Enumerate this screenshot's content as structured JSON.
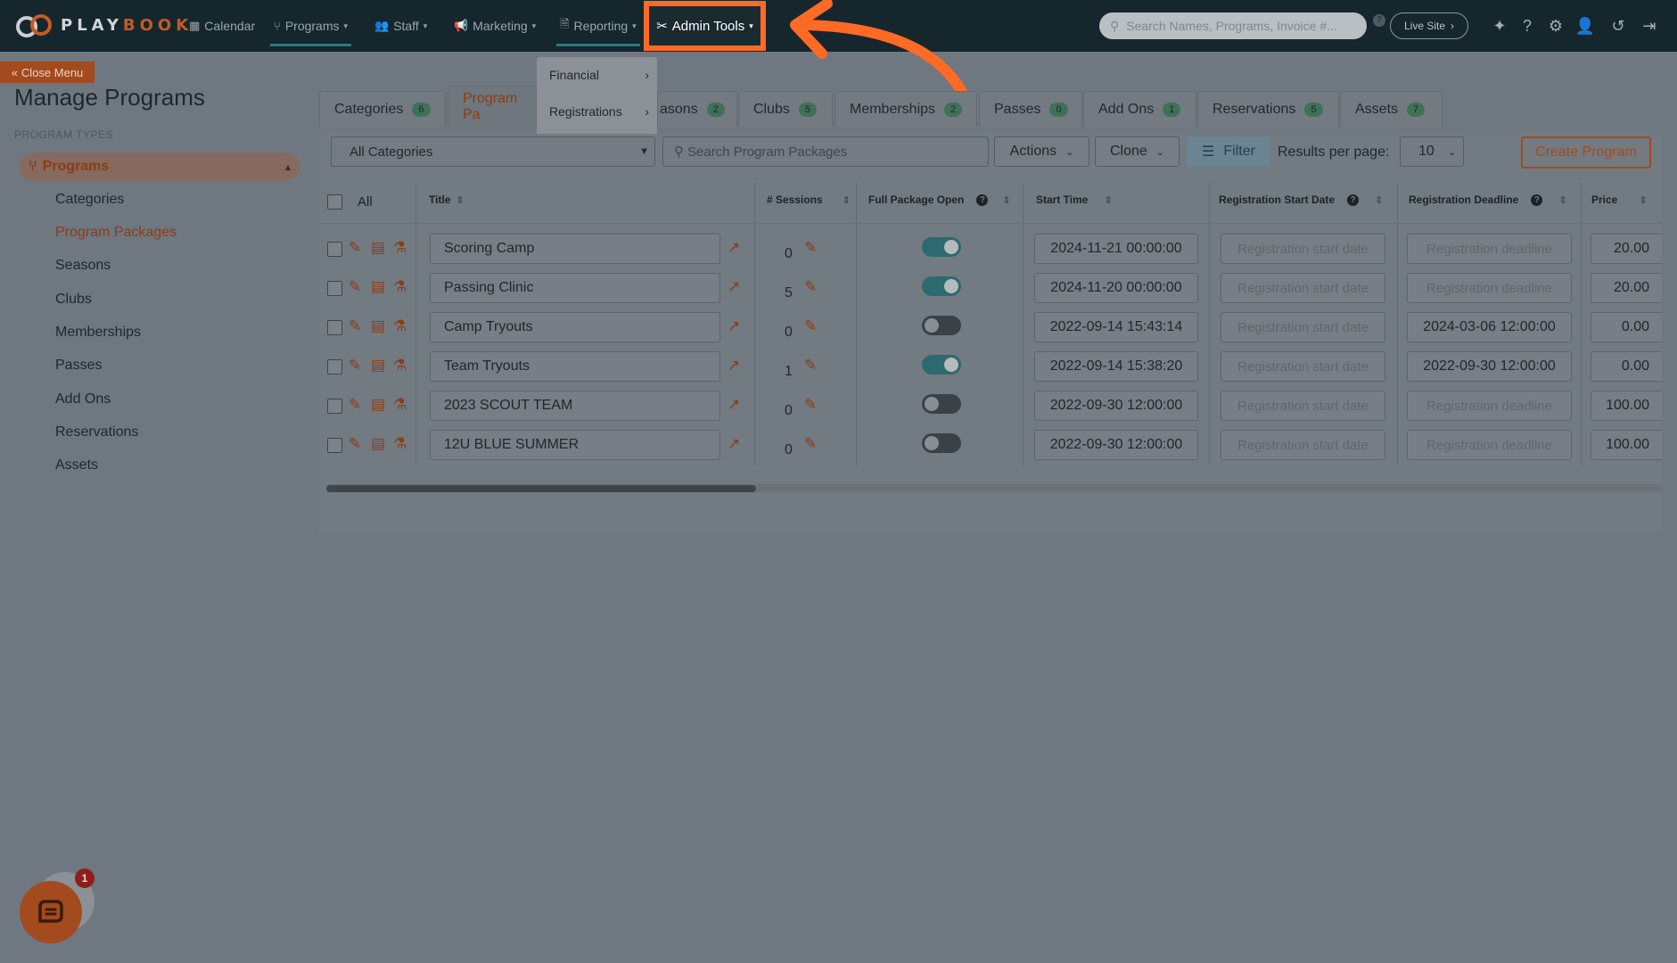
{
  "brand": {
    "play": "PLAY",
    "book": "BOOK"
  },
  "nav": {
    "calendar": "Calendar",
    "programs": "Programs",
    "staff": "Staff",
    "marketing": "Marketing",
    "reporting": "Reporting",
    "admin_tools": "Admin Tools",
    "search_placeholder": "Search Names, Programs, Invoice #...",
    "live_site": "Live Site"
  },
  "admin_menu": {
    "items": [
      "Financial",
      "Registrations"
    ]
  },
  "sidebar": {
    "close_menu": "Close Menu",
    "page_title": "Manage Programs",
    "section_label": "PROGRAM TYPES",
    "programs": "Programs",
    "links": [
      "Categories",
      "Program Packages",
      "Seasons",
      "Clubs",
      "Memberships",
      "Passes",
      "Add Ons",
      "Reservations",
      "Assets"
    ]
  },
  "tabs": [
    {
      "label": "Categories",
      "count": "6"
    },
    {
      "label": "Program Pa",
      "count": ""
    },
    {
      "label": "asons",
      "count": "2"
    },
    {
      "label": "Clubs",
      "count": "5"
    },
    {
      "label": "Memberships",
      "count": "2"
    },
    {
      "label": "Passes",
      "count": "0"
    },
    {
      "label": "Add Ons",
      "count": "1"
    },
    {
      "label": "Reservations",
      "count": "5"
    },
    {
      "label": "Assets",
      "count": "7"
    }
  ],
  "toolbar": {
    "category": "All Categories",
    "search_placeholder": "Search Program Packages",
    "actions": "Actions",
    "clone": "Clone",
    "filter": "Filter",
    "results_label": "Results per page:",
    "results_value": "10",
    "create": "Create Program"
  },
  "table": {
    "headers": {
      "all": "All",
      "title": "Title",
      "sessions": "# Sessions",
      "full_package": "Full Package Open",
      "start_time": "Start Time",
      "reg_start": "Registration Start Date",
      "reg_deadline": "Registration Deadline",
      "price": "Price"
    },
    "reg_start_placeholder": "Registration start date",
    "reg_deadline_placeholder": "Registration deadline",
    "rows": [
      {
        "title": "Scoring Camp",
        "sessions": "0",
        "open": true,
        "start": "2024-11-21 00:00:00",
        "deadline": "",
        "price": "20.00"
      },
      {
        "title": "Passing Clinic",
        "sessions": "5",
        "open": true,
        "start": "2024-11-20 00:00:00",
        "deadline": "",
        "price": "20.00"
      },
      {
        "title": "Camp Tryouts",
        "sessions": "0",
        "open": false,
        "start": "2022-09-14 15:43:14",
        "deadline": "2024-03-06 12:00:00",
        "price": "0.00"
      },
      {
        "title": "Team Tryouts",
        "sessions": "1",
        "open": true,
        "start": "2022-09-14 15:38:20",
        "deadline": "2022-09-30 12:00:00",
        "price": "0.00"
      },
      {
        "title": "2023 SCOUT TEAM",
        "sessions": "0",
        "open": false,
        "start": "2022-09-30 12:00:00",
        "deadline": "",
        "price": "100.00"
      },
      {
        "title": "12U BLUE SUMMER",
        "sessions": "0",
        "open": false,
        "start": "2022-09-30 12:00:00",
        "deadline": "",
        "price": "100.00"
      }
    ]
  },
  "chat": {
    "badge": "1"
  },
  "colors": {
    "accent": "#a34a1e",
    "highlight": "#ff6a24",
    "nav_bg": "#16262d"
  }
}
